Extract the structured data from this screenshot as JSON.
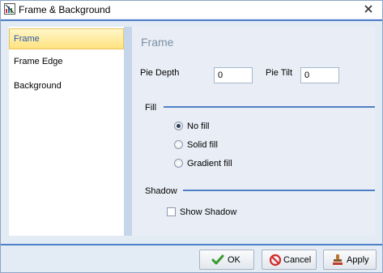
{
  "window": {
    "title": "Frame & Background",
    "close_icon": "close-icon",
    "title_icon": "chart-icon"
  },
  "nav": {
    "items": [
      {
        "label": "Frame",
        "selected": true
      },
      {
        "label": "Frame Edge",
        "selected": false
      },
      {
        "label": "Background",
        "selected": false
      }
    ]
  },
  "content": {
    "section_title": "Frame",
    "pie_depth_label": "Pie Depth",
    "pie_depth_value": "0",
    "pie_tilt_label": "Pie Tilt",
    "pie_tilt_value": "0",
    "fill": {
      "group_label": "Fill",
      "options": [
        {
          "label": "No fill",
          "checked": true
        },
        {
          "label": "Solid fill",
          "checked": false
        },
        {
          "label": "Gradient fill",
          "checked": false
        }
      ]
    },
    "shadow": {
      "group_label": "Shadow",
      "show_shadow_label": "Show Shadow",
      "show_shadow_checked": false
    }
  },
  "buttons": {
    "ok": "OK",
    "cancel": "Cancel",
    "apply": "Apply"
  },
  "colors": {
    "accent": "#4f7fc6",
    "selected_bg": "#ffe27f",
    "panel_bg": "#e3ebf5"
  }
}
